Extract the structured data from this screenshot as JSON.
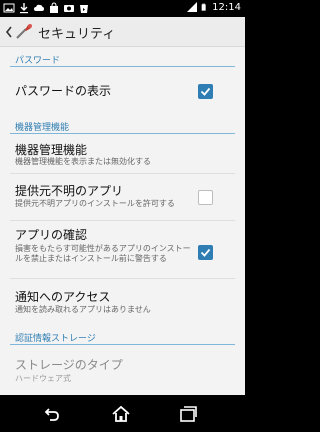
{
  "status_bar": {
    "time": "12:14",
    "left_icons": [
      "photo-icon",
      "download-icon",
      "cloud-icon",
      "shopping-bag-icon",
      "camera-icon",
      "store-icon"
    ],
    "right_icons": [
      "signal-icon",
      "battery-icon"
    ]
  },
  "action_bar": {
    "title": "セキュリティ",
    "accent": "#2f7eb3"
  },
  "sections": {
    "password": {
      "header": "パスワード",
      "show_password": {
        "title": "パスワードの表示",
        "checked": true
      }
    },
    "device_admin": {
      "header": "機器管理機能",
      "device_admin_item": {
        "title": "機器管理機能",
        "summary": "機器管理機能を表示または無効化する"
      },
      "unknown_sources": {
        "title": "提供元不明のアプリ",
        "summary": "提供元不明アプリのインストールを許可する",
        "checked": false
      },
      "verify_apps": {
        "title": "アプリの確認",
        "summary": "損害をもたらす可能性があるアプリのインストールを禁止またはインストール前に警告する",
        "checked": true
      },
      "notification_access": {
        "title": "通知へのアクセス",
        "summary": "通知を読み取れるアプリはありません"
      }
    },
    "credentials": {
      "header": "認証情報ストレージ",
      "storage_type": {
        "title": "ストレージのタイプ",
        "summary": "ハードウェア式"
      }
    }
  },
  "nav_bar": {
    "buttons": [
      "back-icon",
      "home-icon",
      "recent-apps-icon"
    ]
  }
}
